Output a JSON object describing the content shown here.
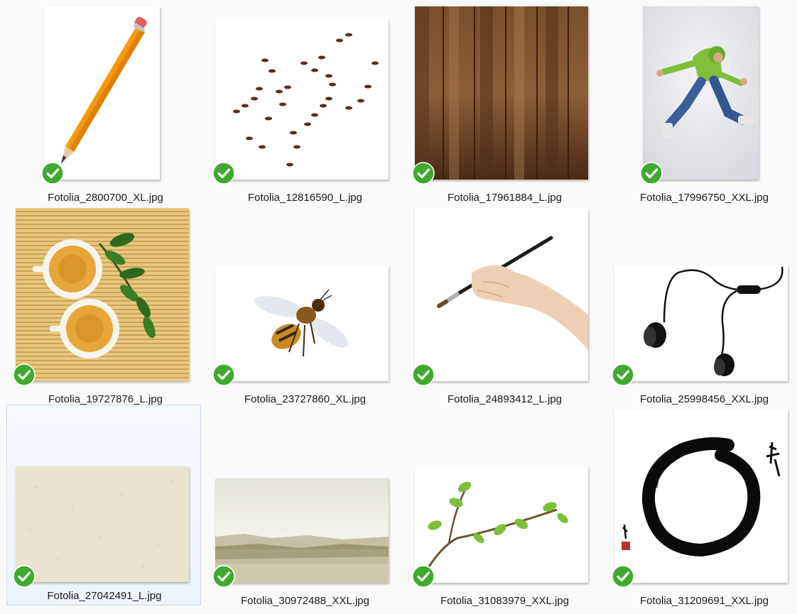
{
  "files": [
    {
      "filename": "Fotolia_2800700_XL.jpg",
      "icon": "pencil-image-icon",
      "synced": true
    },
    {
      "filename": "Fotolia_12816590_L.jpg",
      "icon": "ants-image-icon",
      "synced": true
    },
    {
      "filename": "Fotolia_17961884_L.jpg",
      "icon": "wood-planks-image-icon",
      "synced": true
    },
    {
      "filename": "Fotolia_17996750_XXL.jpg",
      "icon": "jumping-man-image-icon",
      "synced": true
    },
    {
      "filename": "Fotolia_19727876_L.jpg",
      "icon": "tea-cups-image-icon",
      "synced": true
    },
    {
      "filename": "Fotolia_23727860_XL.jpg",
      "icon": "bee-image-icon",
      "synced": true
    },
    {
      "filename": "Fotolia_24893412_L.jpg",
      "icon": "hand-brush-image-icon",
      "synced": true
    },
    {
      "filename": "Fotolia_25998456_XXL.jpg",
      "icon": "earphones-image-icon",
      "synced": true
    },
    {
      "filename": "Fotolia_27042491_L.jpg",
      "icon": "paper-texture-image-icon",
      "synced": true,
      "selected": true
    },
    {
      "filename": "Fotolia_30972488_XXL.jpg",
      "icon": "misty-landscape-image-icon",
      "synced": true
    },
    {
      "filename": "Fotolia_31083979_XXL.jpg",
      "icon": "green-branch-image-icon",
      "synced": true
    },
    {
      "filename": "Fotolia_31209691_XXL.jpg",
      "icon": "enso-circle-image-icon",
      "synced": true
    }
  ],
  "colors": {
    "background": "#fafafa",
    "selection_fill": "#f0f5fc",
    "selection_border": "#c5d9ef",
    "check_green": "#3faa2e"
  }
}
